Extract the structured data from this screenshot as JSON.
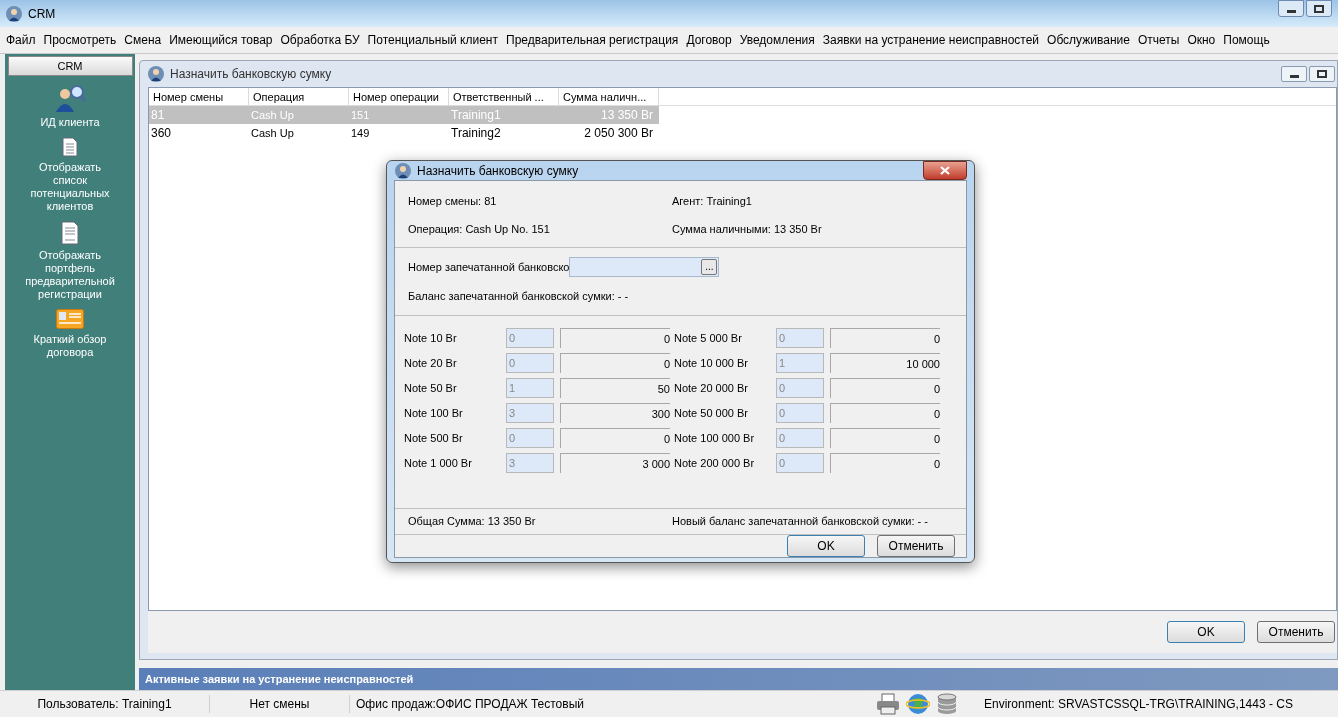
{
  "app": {
    "title": "CRM"
  },
  "menu": [
    "Файл",
    "Просмотреть",
    "Смена",
    "Имеющийся товар",
    "Обработка БУ",
    "Потенциальный клиент",
    "Предварительная регистрация",
    "Договор",
    "Уведомления",
    "Заявки на устранение неисправностей",
    "Обслуживание",
    "Отчеты",
    "Окно",
    "Помощь"
  ],
  "sidebar": {
    "header": "CRM",
    "items": [
      {
        "kind": "user",
        "label": "ИД клиента"
      },
      {
        "kind": "doc",
        "label": "Отображать список потенциальных клиентов"
      },
      {
        "kind": "form",
        "label": "Отображать портфель предварительной регистрации"
      },
      {
        "kind": "card",
        "label": "Краткий обзор договора"
      }
    ]
  },
  "inner_window": {
    "title": "Назначить банковскую сумку",
    "table": {
      "columns": [
        "Номер смены",
        "Операция",
        "Номер операции",
        "Ответственный ...",
        "Сумма наличн..."
      ],
      "rows": [
        {
          "selected": true,
          "cells": [
            "81",
            "Cash Up",
            "151",
            "Training1",
            "13 350 Br"
          ]
        },
        {
          "selected": false,
          "cells": [
            "360",
            "Cash Up",
            "149",
            "Training2",
            "2 050 300 Br"
          ]
        }
      ]
    },
    "buttons": [
      "OK",
      "Отменить"
    ]
  },
  "dialog": {
    "title": "Назначить банковскую сумку",
    "info": [
      {
        "label": "Номер смены:",
        "value": "81"
      },
      {
        "label": "Агент:",
        "value": "Training1"
      },
      {
        "label": "Операция:",
        "value": "Cash Up No. 151"
      },
      {
        "label": "Сумма наличными:",
        "value": "13 350 Br"
      }
    ],
    "bag_number_label": "Номер запечатанной банковско",
    "browse_button": "...",
    "bag_balance": "Баланс запечатанной банковской сумки: - -",
    "notes_left": [
      {
        "label": "Note 10 Br",
        "count": "0",
        "amount": "0"
      },
      {
        "label": "Note 20 Br",
        "count": "0",
        "amount": "0"
      },
      {
        "label": "Note 50 Br",
        "count": "1",
        "amount": "50"
      },
      {
        "label": "Note 100 Br",
        "count": "3",
        "amount": "300"
      },
      {
        "label": "Note 500 Br",
        "count": "0",
        "amount": "0"
      },
      {
        "label": "Note 1 000 Br",
        "count": "3",
        "amount": "3 000"
      }
    ],
    "notes_right": [
      {
        "label": "Note 5 000 Br",
        "count": "0",
        "amount": "0"
      },
      {
        "label": "Note 10 000 Br",
        "count": "1",
        "amount": "10 000"
      },
      {
        "label": "Note 20 000 Br",
        "count": "0",
        "amount": "0"
      },
      {
        "label": "Note 50 000 Br",
        "count": "0",
        "amount": "0"
      },
      {
        "label": "Note 100 000 Br",
        "count": "0",
        "amount": "0"
      },
      {
        "label": "Note 200 000 Br",
        "count": "0",
        "amount": "0"
      }
    ],
    "total": "Общая Сумма: 13 350 Br",
    "new_balance": "Новый баланс запечатанной банковской сумки: - -",
    "buttons": [
      "OK",
      "Отменить"
    ]
  },
  "active_requests_bar": "Активные заявки на устранение неисправностей",
  "status_bar": {
    "user": "Пользователь: Training1",
    "shift": "Нет смены",
    "office": "Офис продаж:ОФИС ПРОДАЖ Тестовый",
    "environment": "Environment: SRVASTCSSQL-TRG\\TRAINING,1443 - CS"
  }
}
